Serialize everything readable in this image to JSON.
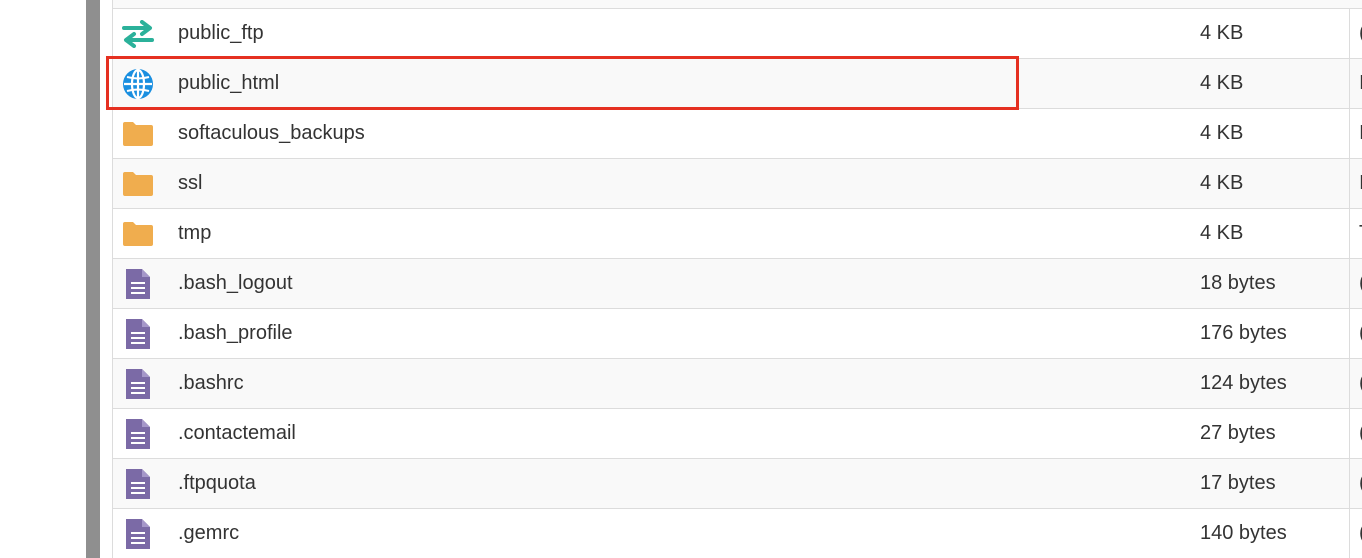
{
  "files": [
    {
      "name": "public_ftp",
      "size": "4 KB",
      "icon": "ftp-transfer-icon",
      "next_col": "("
    },
    {
      "name": "public_html",
      "size": "4 KB",
      "icon": "globe-icon",
      "next_col": "I"
    },
    {
      "name": "softaculous_backups",
      "size": "4 KB",
      "icon": "folder-icon",
      "next_col": "I"
    },
    {
      "name": "ssl",
      "size": "4 KB",
      "icon": "folder-icon",
      "next_col": "I"
    },
    {
      "name": "tmp",
      "size": "4 KB",
      "icon": "folder-icon",
      "next_col": "T"
    },
    {
      "name": ".bash_logout",
      "size": "18 bytes",
      "icon": "text-file-icon",
      "next_col": "("
    },
    {
      "name": ".bash_profile",
      "size": "176 bytes",
      "icon": "text-file-icon",
      "next_col": "("
    },
    {
      "name": ".bashrc",
      "size": "124 bytes",
      "icon": "text-file-icon",
      "next_col": "("
    },
    {
      "name": ".contactemail",
      "size": "27 bytes",
      "icon": "text-file-icon",
      "next_col": "("
    },
    {
      "name": ".ftpquota",
      "size": "17 bytes",
      "icon": "text-file-icon",
      "next_col": "("
    },
    {
      "name": ".gemrc",
      "size": "140 bytes",
      "icon": "text-file-icon",
      "next_col": "("
    }
  ],
  "colors": {
    "folder": "#f0ad4e",
    "text_file": "#7b6aa6",
    "globe": "#1a8fe0",
    "ftp_arrows": "#2bb19a",
    "highlight": "#e53021"
  }
}
